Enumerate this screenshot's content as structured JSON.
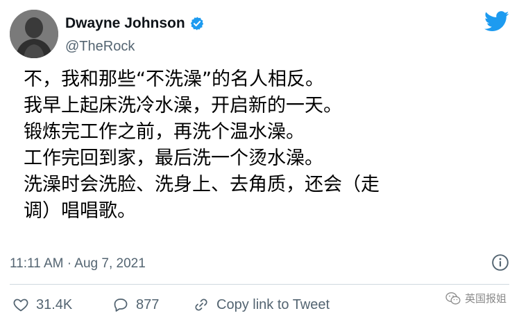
{
  "user": {
    "display_name": "Dwayne Johnson",
    "handle": "@TheRock"
  },
  "tweet": {
    "lines": [
      "不，我和那些“不洗澡”的名人相反。",
      "我早上起床洗冷水澡，开启新的一天。",
      "锻炼完工作之前，再洗个温水澡。",
      "工作完回到家，最后洗一个烫水澡。",
      "洗澡时会洗脸、洗身上、去角质，还会（走",
      "调）唱唱歌。"
    ],
    "timestamp": "11:11 AM · Aug 7, 2021"
  },
  "actions": {
    "likes": "31.4K",
    "replies": "877",
    "copy_link": "Copy link to Tweet"
  },
  "watermark": {
    "text": "英国报姐"
  },
  "colors": {
    "twitter_blue": "#1d9bf0",
    "secondary_text": "#536471",
    "divider": "#cfd9de"
  },
  "icons": [
    "verified-badge-icon",
    "twitter-bird-icon",
    "info-icon",
    "heart-icon",
    "reply-bubble-icon",
    "link-icon",
    "wechat-icon"
  ]
}
